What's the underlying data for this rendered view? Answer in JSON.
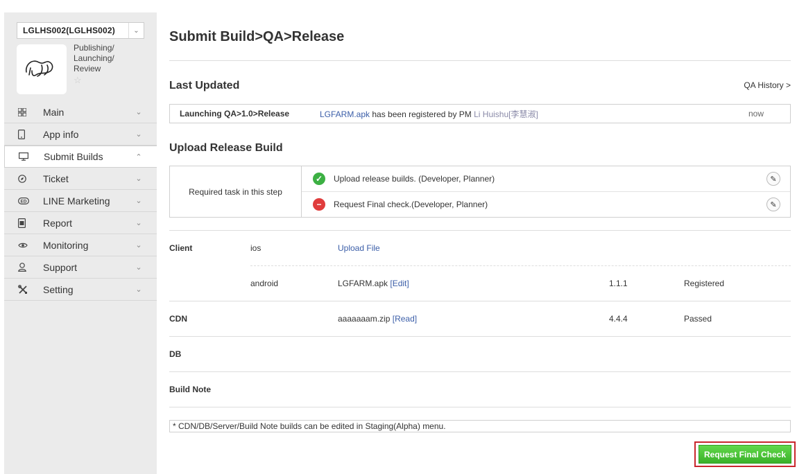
{
  "sidebar": {
    "app_selector": {
      "value": "LGLHS002(LGLHS002)"
    },
    "app_status": {
      "line1": "Publishing/",
      "line2": "Launching/",
      "line3": "Review"
    },
    "menu": [
      {
        "label": "Main",
        "icon": "grid-icon",
        "chevron": "chevron-down"
      },
      {
        "label": "App info",
        "icon": "phone-icon",
        "chevron": "chevron-down"
      },
      {
        "label": "Submit Builds",
        "icon": "monitor-icon",
        "chevron": "chevron-up",
        "active": true
      },
      {
        "label": "Ticket",
        "icon": "compass-icon",
        "chevron": "chevron-down"
      },
      {
        "label": "LINE Marketing",
        "icon": "line-icon",
        "chevron": "chevron-down"
      },
      {
        "label": "Report",
        "icon": "report-icon",
        "chevron": "chevron-down"
      },
      {
        "label": "Monitoring",
        "icon": "eye-icon",
        "chevron": "chevron-down"
      },
      {
        "label": "Support",
        "icon": "user-icon",
        "chevron": "chevron-down"
      },
      {
        "label": "Setting",
        "icon": "tools-icon",
        "chevron": "chevron-down"
      }
    ]
  },
  "main": {
    "title": "Submit Build>QA>Release",
    "last_updated": {
      "title": "Last Updated",
      "history_link": "QA History >",
      "step": "Launching QA>1.0>Release",
      "file_link": "LGFARM.apk",
      "message": " has been registered by PM ",
      "pm_name": "Li Huishu[李慧淑]",
      "time": "now"
    },
    "upload": {
      "title": "Upload Release Build",
      "required_label": "Required task in this step",
      "tasks": [
        {
          "text": "Upload release builds. (Developer, Planner)",
          "status": "done"
        },
        {
          "text": "Request Final check.(Developer, Planner)",
          "status": "pending"
        }
      ]
    },
    "builds": {
      "client_label": "Client",
      "ios": {
        "platform": "ios",
        "action": "Upload File"
      },
      "android": {
        "platform": "android",
        "file": "LGFARM.apk",
        "action": "[Edit]",
        "version": "1.1.1",
        "status": "Registered"
      },
      "cdn": {
        "label": "CDN",
        "file": "aaaaaaam.zip",
        "action": "[Read]",
        "version": "4.4.4",
        "status": "Passed"
      },
      "db": {
        "label": "DB"
      },
      "build_note": {
        "label": "Build Note"
      }
    },
    "note": "* CDN/DB/Server/Build Note builds can be edited in Staging(Alpha) menu.",
    "final_button": "Request Final Check"
  },
  "colors": {
    "accent_link": "#3b5ea8",
    "success": "#3cb043",
    "error": "#e03c3c",
    "button_green": "#4cc436",
    "highlight_red": "#c9262c"
  }
}
